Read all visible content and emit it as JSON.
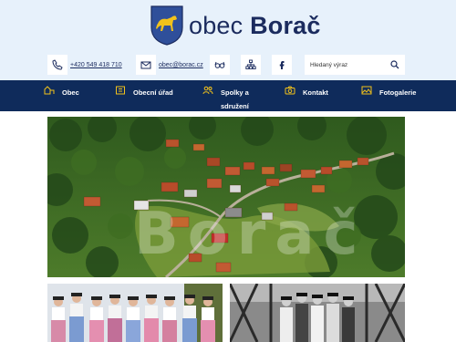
{
  "site": {
    "name_light": "obec",
    "name_bold": "Borač"
  },
  "contact": {
    "phone": "+420 549 418 710",
    "email": "obec@borac.cz"
  },
  "icons": [
    "phone-icon",
    "mail-icon",
    "glasses-icon",
    "sitemap-icon",
    "facebook-icon",
    "search-icon"
  ],
  "search": {
    "placeholder": "Hledaný výraz"
  },
  "nav": [
    {
      "label": "Obec",
      "icon": "village-icon"
    },
    {
      "label": "Obecní úřad",
      "icon": "office-icon"
    },
    {
      "label": "Spolky a sdružení",
      "icon": "people-icon"
    },
    {
      "label": "Kontakt",
      "icon": "camera-icon"
    },
    {
      "label": "Fotogalerie",
      "icon": "gallery-icon"
    }
  ],
  "hero": {
    "watermark": "Borač"
  },
  "colors": {
    "nav_bg": "#0f2b5b",
    "header_bg": "#e7f1fb",
    "brand": "#1b2b5e",
    "shield_blue": "#2f4f9a",
    "horse_gold": "#f2c21b"
  }
}
